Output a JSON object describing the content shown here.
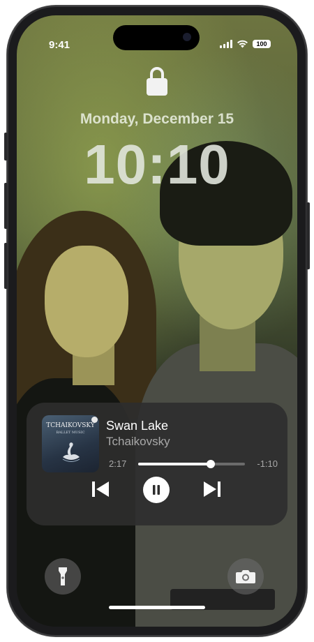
{
  "status_bar": {
    "time": "9:41",
    "battery": "100"
  },
  "lock_screen": {
    "date": "Monday, December 15",
    "clock": "10:10"
  },
  "now_playing": {
    "title": "Swan Lake",
    "artist": "Tchaikovsky",
    "album_art_title": "TCHAIKOVSKY",
    "album_art_subtitle": "BALLET MUSIC",
    "elapsed": "2:17",
    "remaining": "-1:10",
    "progress": 0.68
  },
  "icons": {
    "lock": "lock-icon",
    "previous": "backward-end-icon",
    "pause": "pause-icon",
    "next": "forward-end-icon",
    "flashlight": "flashlight-icon",
    "camera": "camera-icon"
  },
  "colors": {
    "player_background": "#2d2d2d",
    "progress_track": "#6b6b6b",
    "accent": "#ffffff"
  }
}
